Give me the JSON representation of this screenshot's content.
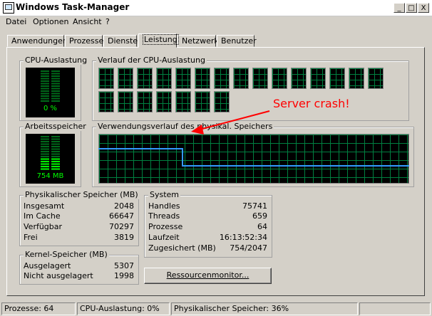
{
  "window": {
    "title": "Windows Task-Manager",
    "buttons": [
      "_",
      "□",
      "X"
    ]
  },
  "menu": [
    "Datei",
    "Optionen",
    "Ansicht",
    "?"
  ],
  "tabs": [
    "Anwendungen",
    "Prozesse",
    "Dienste",
    "Leistung",
    "Netzwerk",
    "Benutzer"
  ],
  "active_tab": "Leistung",
  "cpu": {
    "title": "CPU-Auslastung",
    "value": "0 %",
    "history_title": "Verlauf der CPU-Auslastung",
    "core_count": 16
  },
  "memory": {
    "title": "Arbeitsspeicher",
    "value": "754 MB",
    "history_title": "Verwendungsverlauf des physikal. Speichers",
    "history_percent": [
      70,
      70,
      70,
      70,
      70,
      70,
      70,
      70,
      70,
      70,
      36,
      36,
      36,
      36,
      36,
      36,
      36,
      36,
      36,
      36,
      36,
      36,
      36,
      36,
      36,
      36,
      36,
      36,
      36,
      36,
      36,
      36,
      36,
      36,
      36,
      36,
      36,
      36
    ]
  },
  "annotation": "Server crash!",
  "phys": {
    "title": "Physikalischer Speicher (MB)",
    "rows": [
      {
        "label": "Insgesamt",
        "value": "2048"
      },
      {
        "label": "Im Cache",
        "value": "66647"
      },
      {
        "label": "Verfügbar",
        "value": "70297"
      },
      {
        "label": "Frei",
        "value": "3819"
      }
    ]
  },
  "kernel": {
    "title": "Kernel-Speicher (MB)",
    "rows": [
      {
        "label": "Ausgelagert",
        "value": "5307"
      },
      {
        "label": "Nicht ausgelagert",
        "value": "1998"
      }
    ]
  },
  "system": {
    "title": "System",
    "rows": [
      {
        "label": "Handles",
        "value": "75741"
      },
      {
        "label": "Threads",
        "value": "659"
      },
      {
        "label": "Prozesse",
        "value": "64"
      },
      {
        "label": "Laufzeit",
        "value": "16:13:52:34"
      },
      {
        "label": "Zugesichert (MB)",
        "value": "754/2047"
      }
    ]
  },
  "resmon_button": "Ressourcenmonitor...",
  "status": {
    "processes": "Prozesse: 64",
    "cpu": "CPU-Auslastung: 0%",
    "memory": "Physikalischer Speicher: 36%"
  },
  "colors": {
    "graph_bg": "#000000",
    "grid": "#008040",
    "meter_green": "#00ff00",
    "memory_line": "#3399ff",
    "annotation": "#ff0000"
  }
}
